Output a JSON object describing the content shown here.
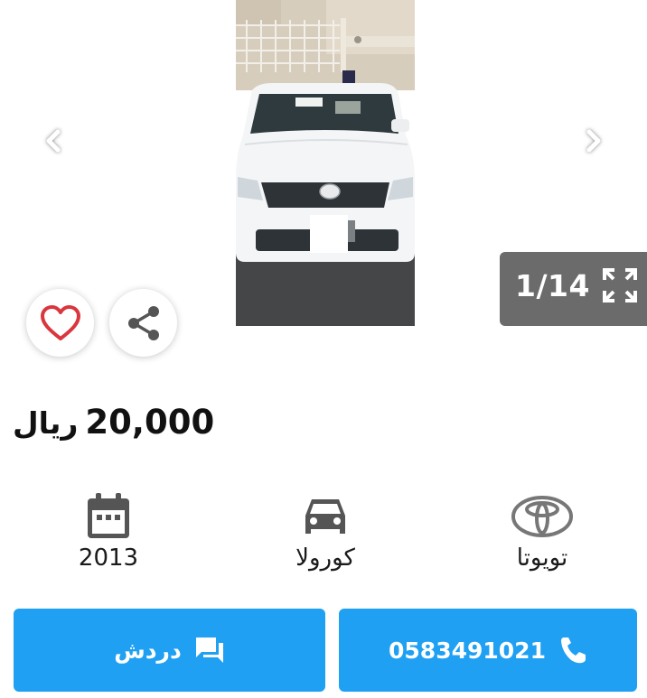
{
  "gallery": {
    "counter": "1/14",
    "icons": {
      "prev": "chevron-left-icon",
      "next": "chevron-right-icon",
      "expand": "expand-icon"
    }
  },
  "actions": {
    "favorite_icon": "heart-icon",
    "share_icon": "share-icon"
  },
  "listing": {
    "price_value": "20,000",
    "price_currency": "ريال"
  },
  "specs": [
    {
      "icon": "toyota-logo-icon",
      "label": "تويوتا"
    },
    {
      "icon": "car-icon",
      "label": "كورولا"
    },
    {
      "icon": "calendar-icon",
      "label": "2013"
    }
  ],
  "buttons": {
    "call_number": "0583491021",
    "chat_label": "دردش",
    "call_icon": "phone-icon",
    "chat_icon": "chat-icon"
  },
  "colors": {
    "primary": "#1fa0f2",
    "heart": "#d9363e",
    "counter_bg": "#6b6b6b",
    "icon_gray": "#555555"
  }
}
